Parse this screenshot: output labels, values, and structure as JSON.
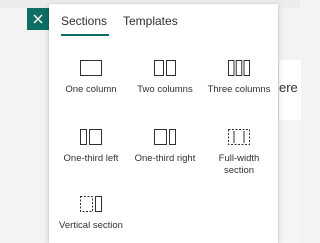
{
  "tabs": {
    "sections": "Sections",
    "templates": "Templates"
  },
  "background": {
    "edge_text": "ere"
  },
  "tiles": [
    {
      "label": "One column"
    },
    {
      "label": "Two columns"
    },
    {
      "label": "Three columns"
    },
    {
      "label": "One-third left"
    },
    {
      "label": "One-third right"
    },
    {
      "label": "Full-width section"
    },
    {
      "label": "Vertical section"
    }
  ],
  "colors": {
    "accent": "#0e6e64",
    "text": "#323130"
  },
  "icons": {
    "close": "close-icon"
  }
}
